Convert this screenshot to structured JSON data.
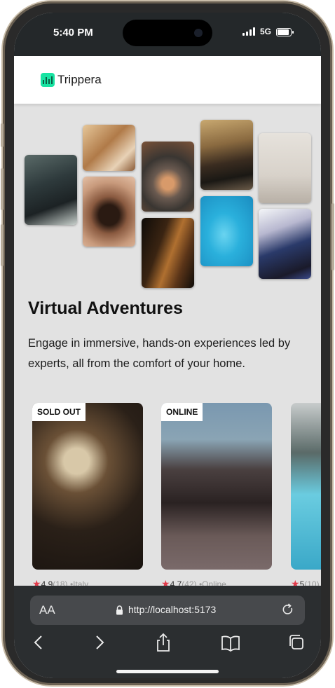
{
  "status": {
    "time": "5:40 PM",
    "network": "5G"
  },
  "app": {
    "brand": "Trippera"
  },
  "hero": {
    "title": "Virtual Adventures",
    "description": "Engage in immersive, hands-on experiences led by experts, all from the comfort of your home."
  },
  "cards": [
    {
      "badge": "SOLD OUT",
      "rating": "4.9",
      "reviews": "(18)",
      "location": "•Italy"
    },
    {
      "badge": "ONLINE",
      "rating": "4.7",
      "reviews": "(42)",
      "location": "•Online"
    },
    {
      "badge": "",
      "rating": "5",
      "reviews": "(10)",
      "location": ""
    }
  ],
  "browser": {
    "text_size_label": "AA",
    "url": "http://localhost:5173"
  },
  "icons": [
    "logo-icon",
    "star-icon",
    "lock-icon",
    "reload-icon",
    "back-icon",
    "forward-icon",
    "share-icon",
    "bookmarks-icon",
    "tabs-icon"
  ],
  "colors": {
    "brand": "#18e3a2",
    "star": "#e23a4a",
    "page_bg": "#e2e2e2",
    "browser_bar": "#2b2e30"
  }
}
